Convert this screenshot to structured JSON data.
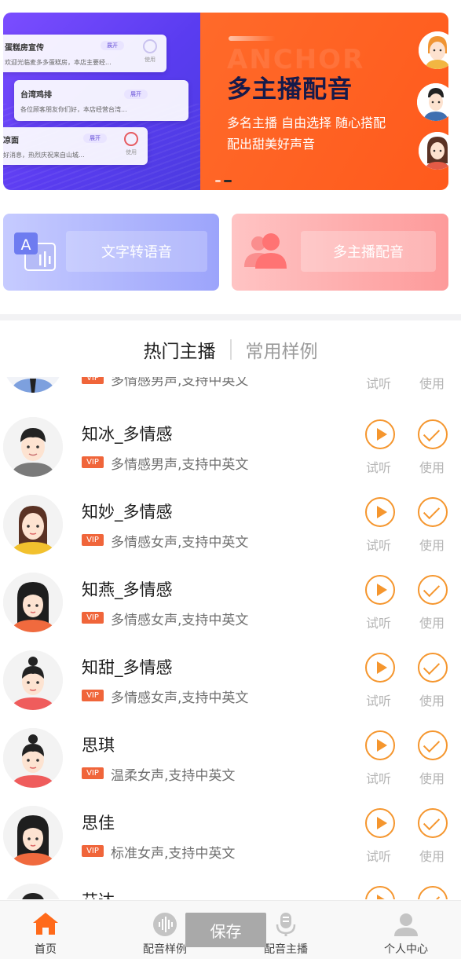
{
  "banner": {
    "slide_title": "多主播配音",
    "slide_sub1": "多名主播  自由选择  随心搭配",
    "slide_sub2": "配出甜美好声音",
    "bg_word": "ANCHOR",
    "cards": [
      {
        "title": "蛋糕房宣传",
        "desc": "欢迎光临麦多多蛋糕房，本店主要经...",
        "badge": "展开",
        "use": "使用"
      },
      {
        "title": "台湾鸡排",
        "desc": "各位顾客朋友你们好，本店经营台湾...",
        "badge": "展开",
        "use": "使用"
      },
      {
        "title": "凉面",
        "desc": "好消息，热烈庆祝来自山城...",
        "badge": "展开",
        "use": "使用"
      }
    ]
  },
  "features": {
    "tts_label": "文字转语音",
    "multi_label": "多主播配音"
  },
  "tabs": [
    {
      "label": "热门主播"
    },
    {
      "label": "常用样例"
    }
  ],
  "voices": [
    {
      "name": "",
      "vip": "VIP",
      "desc": "多情感男声,支持中英文",
      "play": "试听",
      "use": "使用"
    },
    {
      "name": "知冰_多情感",
      "vip": "VIP",
      "desc": "多情感男声,支持中英文",
      "play": "试听",
      "use": "使用"
    },
    {
      "name": "知妙_多情感",
      "vip": "VIP",
      "desc": "多情感女声,支持中英文",
      "play": "试听",
      "use": "使用"
    },
    {
      "name": "知燕_多情感",
      "vip": "VIP",
      "desc": "多情感女声,支持中英文",
      "play": "试听",
      "use": "使用"
    },
    {
      "name": "知甜_多情感",
      "vip": "VIP",
      "desc": "多情感女声,支持中英文",
      "play": "试听",
      "use": "使用"
    },
    {
      "name": "思琪",
      "vip": "VIP",
      "desc": "温柔女声,支持中英文",
      "play": "试听",
      "use": "使用"
    },
    {
      "name": "思佳",
      "vip": "VIP",
      "desc": "标准女声,支持中英文",
      "play": "试听",
      "use": "使用"
    },
    {
      "name": "艾达",
      "vip": "",
      "desc": "",
      "play": "",
      "use": ""
    }
  ],
  "nav": [
    {
      "label": "首页",
      "icon": "home-icon"
    },
    {
      "label": "配音样例",
      "icon": "waveform-icon"
    },
    {
      "label": "配音主播",
      "icon": "microphone-icon"
    },
    {
      "label": "个人中心",
      "icon": "user-icon"
    }
  ],
  "save_label": "保存",
  "colors": {
    "accent": "#f5962e",
    "nav_active": "#ff6a1a",
    "vip": "#f0653a"
  }
}
